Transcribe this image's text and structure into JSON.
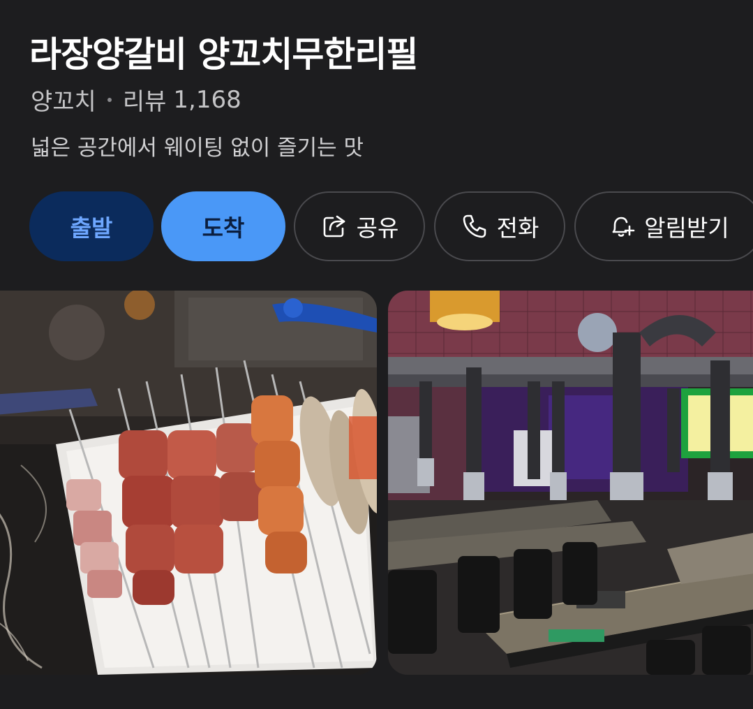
{
  "place": {
    "name": "라장양갈비 양꼬치무한리필",
    "category": "양꼬치",
    "review_label": "리뷰",
    "review_count": "1,168",
    "description": "넓은 공간에서 웨이팅 없이 즐기는 맛"
  },
  "actions": {
    "depart": "출발",
    "arrive": "도착",
    "share": "공유",
    "call": "전화",
    "notify": "알림받기"
  },
  "icons": {
    "share": "share-icon",
    "call": "phone-icon",
    "notify": "bell-plus-icon"
  },
  "photos": [
    {
      "name": "skewers-photo"
    },
    {
      "name": "restaurant-interior-photo"
    }
  ],
  "colors": {
    "background": "#1d1d1f",
    "depart_bg": "#0b2b5c",
    "depart_text": "#6ea7ff",
    "arrive_bg": "#4a98f7",
    "arrive_text": "#0b1e3e"
  }
}
